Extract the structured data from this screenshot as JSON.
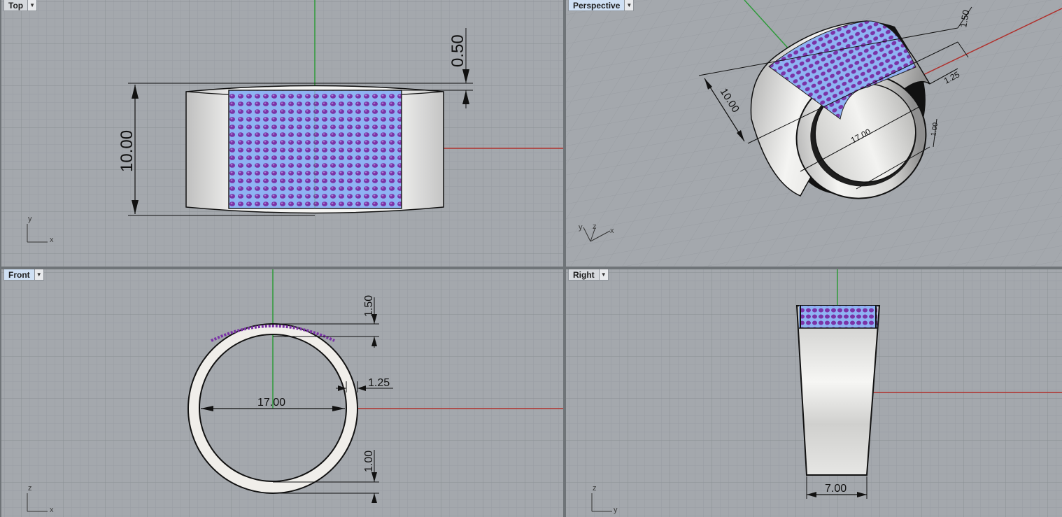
{
  "viewports": {
    "top": {
      "label": "Top",
      "axis_v": "y",
      "axis_h": "x",
      "dims": {
        "width": "10.00",
        "top_gap": "0.50"
      }
    },
    "perspective": {
      "label": "Perspective",
      "axis_a": "y",
      "axis_b": "z",
      "axis_c": "x",
      "dims": {
        "height": "1.50",
        "band": "1.25",
        "width": "10.00",
        "diameter": "17.00",
        "bottom": "1.00"
      }
    },
    "front": {
      "label": "Front",
      "axis_v": "z",
      "axis_h": "x",
      "dims": {
        "top": "1.50",
        "side": "1.25",
        "diameter": "17.00",
        "bottom": "1.00"
      }
    },
    "right": {
      "label": "Right",
      "axis_v": "z",
      "axis_h": "y",
      "dims": {
        "bottom_width": "7.00"
      }
    }
  },
  "colors": {
    "grid_bg": "#a4a8ad",
    "grid_minor": "#9a9ea3",
    "grid_major": "#8b9095",
    "x_axis": "#b0302c",
    "y_axis": "#2e9a3a",
    "gem_blue": "#8fb4f5",
    "gem_purple": "#7a2fa0",
    "metal": "#e8e6e2"
  }
}
